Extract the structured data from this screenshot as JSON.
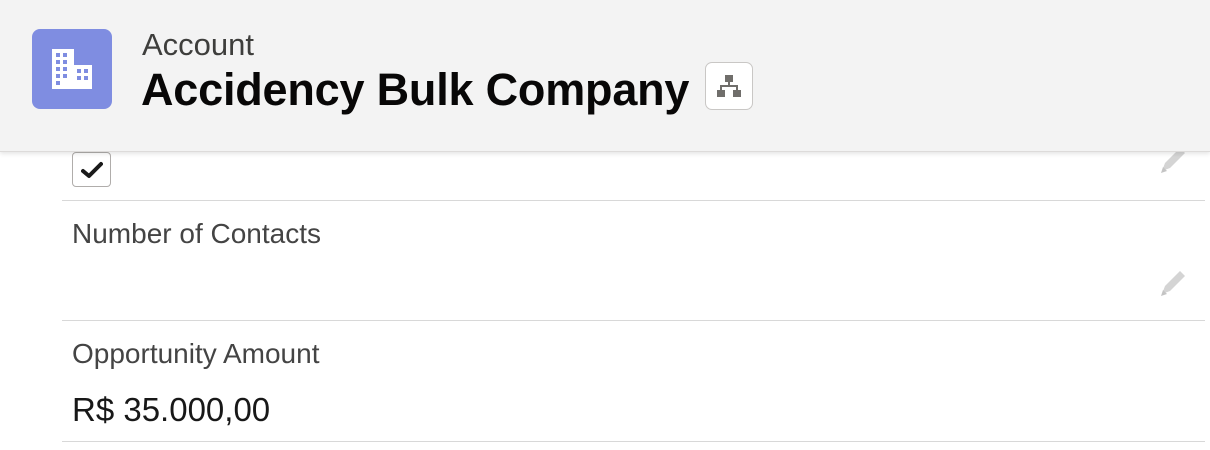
{
  "header": {
    "object_type": "Account",
    "record_name": "Accidency Bulk Company",
    "entity_icon": "account-building-icon",
    "hierarchy_icon": "hierarchy-icon",
    "icon_color": "#7f8de1"
  },
  "fields": {
    "checkbox_field": {
      "checked": true
    },
    "number_of_contacts": {
      "label": "Number of Contacts",
      "value": ""
    },
    "opportunity_amount": {
      "label": "Opportunity Amount",
      "value": "R$ 35.000,00"
    }
  },
  "icons": {
    "edit": "pencil-edit-icon",
    "check": "checkmark-icon"
  }
}
